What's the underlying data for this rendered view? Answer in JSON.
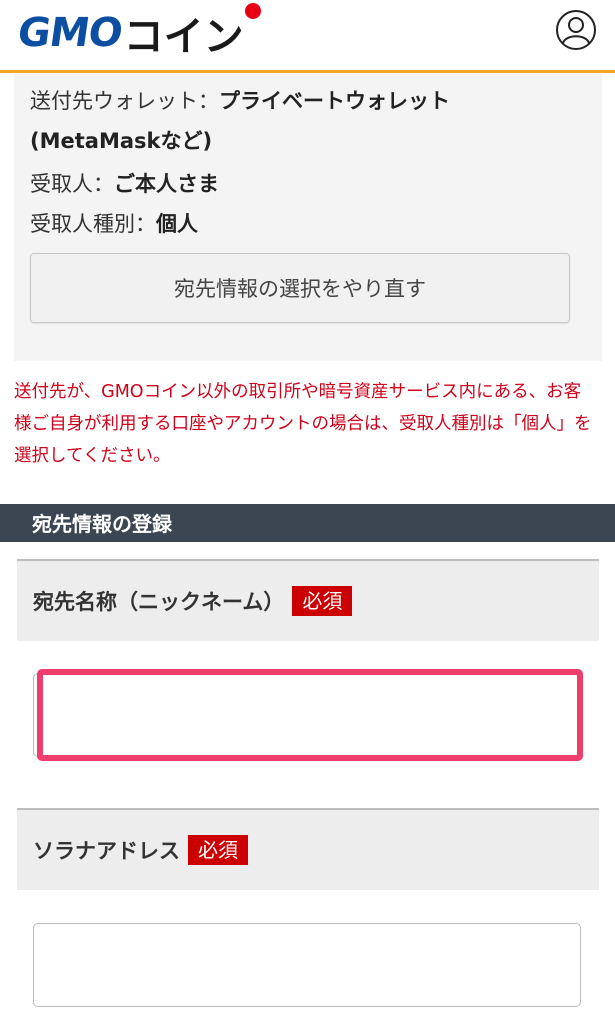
{
  "header": {
    "logo_gmo": "GMO",
    "logo_coin": "コイン",
    "brand_color": "#0b4ea2",
    "accent_color": "#f5a623",
    "dot_color": "#e60012",
    "account_icon": "user-circle-icon"
  },
  "summary": {
    "wallet_label": "送付先ウォレット：",
    "wallet_value": "プライベートウォレット",
    "wallet_value_2": "(MetaMaskなど)",
    "recipient_label": "受取人：",
    "recipient_value": "ご本人さま",
    "recipient_type_label": "受取人種別：",
    "recipient_type_value": "個人",
    "reselect_button": "宛先情報の選択をやり直す"
  },
  "notice": {
    "text": "送付先が、GMOコイン以外の取引所や暗号資産サービス内にある、お客様ご自身が利用する口座やアカウントの場合は、受取人種別は「個人」を選択してください。",
    "color": "#d0021b"
  },
  "registration": {
    "section_title": "宛先情報の登録",
    "nickname_label": "宛先名称（ニックネーム）",
    "nickname_required": "必須",
    "nickname_value": "",
    "address_label": "ソラナアドレス",
    "address_required": "必須",
    "address_value": "",
    "highlight_color": "#ef3e6e"
  }
}
